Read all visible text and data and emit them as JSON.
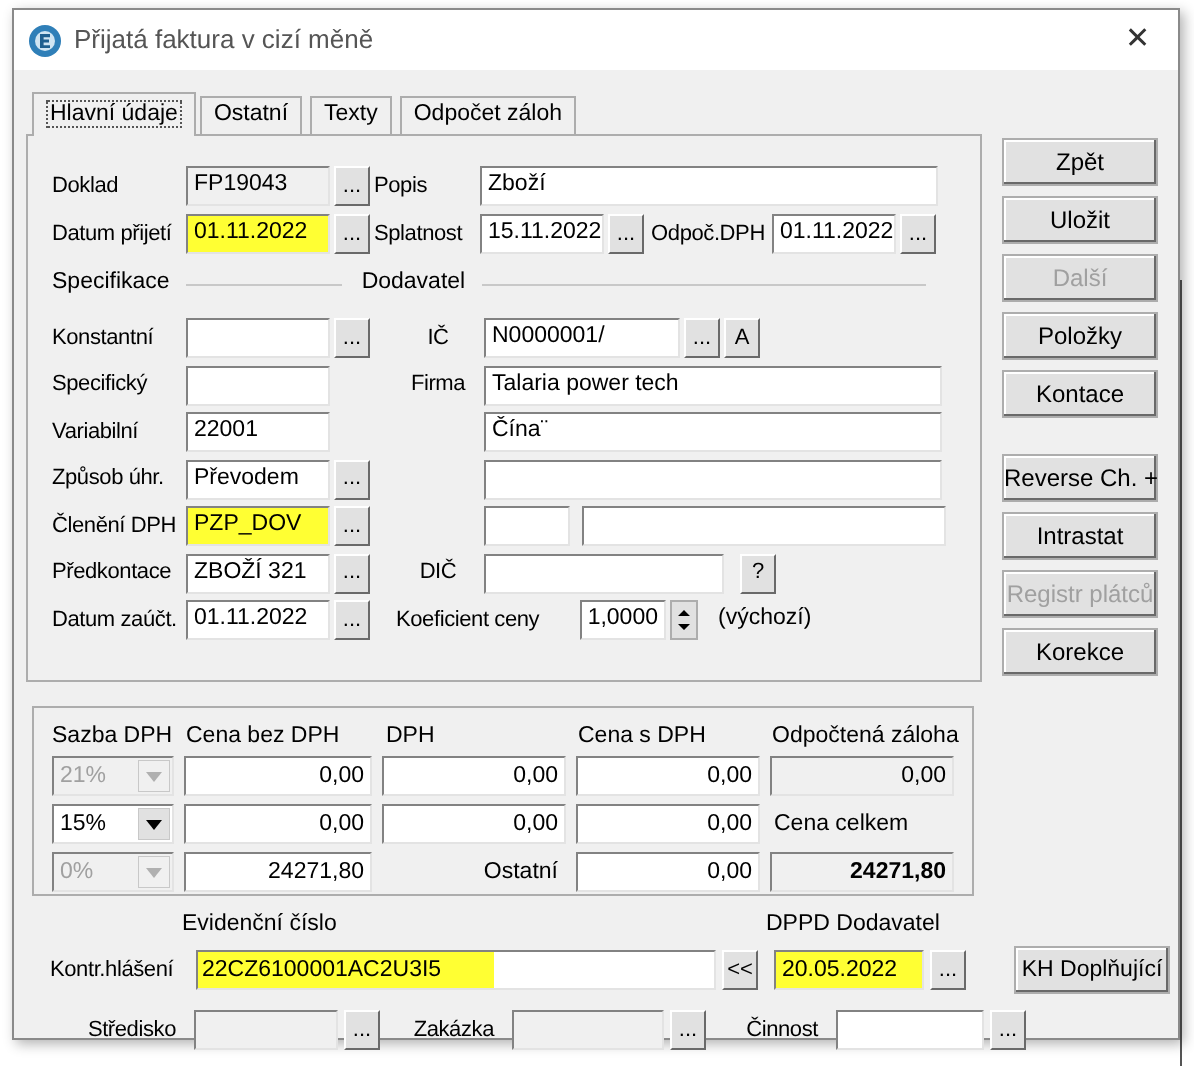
{
  "window": {
    "title": "Přijatá faktura v cizí měně",
    "close": "✕"
  },
  "tabs": [
    {
      "label": "Hlavní údaje",
      "selected": true
    },
    {
      "label": "Ostatní",
      "selected": false
    },
    {
      "label": "Texty",
      "selected": false
    },
    {
      "label": "Odpočet záloh",
      "selected": false
    }
  ],
  "main": {
    "doklad": {
      "label": "Doklad",
      "value": "FP19043",
      "readonly": true,
      "picker": "..."
    },
    "popis": {
      "label": "Popis",
      "value": "Zboží"
    },
    "datum_prijeti": {
      "label": "Datum přijetí",
      "value": "01.11.2022",
      "highlighted": true,
      "picker": "..."
    },
    "splatnost": {
      "label": "Splatnost",
      "value": "15.11.2022",
      "picker": "..."
    },
    "odpoc_dph": {
      "label": "Odpoč.DPH",
      "value": "01.11.2022",
      "picker": "..."
    },
    "specifikace_heading": "Specifikace",
    "dodavatel_heading": "Dodavatel",
    "specifikace": [
      {
        "label": "Konstantní",
        "picker": "...",
        "highlighted": false
      },
      {
        "label": "Specifický",
        "highlighted": false
      },
      {
        "label": "Variabilní",
        "value": "22001",
        "highlighted": false
      },
      {
        "label": "Způsob úhr.",
        "value": "Převodem",
        "picker": "...",
        "highlighted": false
      },
      {
        "label": "Členění DPH",
        "value": "PZP_DOV",
        "picker": "...",
        "highlighted": true
      },
      {
        "label": "Předkontace",
        "value": "ZBOŽÍ 321",
        "picker": "...",
        "highlighted": false
      },
      {
        "label": "Datum zaúčt.",
        "value": "01.11.2022",
        "picker": "...",
        "highlighted": false
      }
    ],
    "ic": {
      "label": "IČ",
      "value": "N0000001/",
      "picker": "...",
      "lookup": "A"
    },
    "firma": {
      "label": "Firma",
      "value": "Talaria power tech"
    },
    "address": [
      "Čína¨"
    ],
    "dic": {
      "label": "DIČ",
      "help": "?"
    },
    "koeficient": {
      "label": "Koeficient ceny",
      "value": "1,0000",
      "note": "(výchozí)"
    }
  },
  "action_groups": [
    {
      "buttons": [
        {
          "label": "Zpět",
          "disabled": false
        },
        {
          "label": "Uložit",
          "disabled": false
        },
        {
          "label": "Další",
          "disabled": true
        },
        {
          "label": "Položky",
          "disabled": false
        },
        {
          "label": "Kontace",
          "disabled": false
        }
      ]
    },
    {
      "buttons": [
        {
          "label": "Reverse Ch. +",
          "disabled": false
        },
        {
          "label": "Intrastat",
          "disabled": false
        },
        {
          "label": "Registr plátců",
          "disabled": true
        },
        {
          "label": "Korekce",
          "disabled": false
        }
      ]
    }
  ],
  "vat": {
    "headers": [
      "Sazba DPH",
      "Cena bez DPH",
      "DPH",
      "Cena s DPH",
      "Odpočtená záloha"
    ],
    "rows": [
      {
        "rate": "21%",
        "disabled": true,
        "base": "0,00",
        "vat": "0,00",
        "total": "0,00"
      },
      {
        "rate": "15%",
        "disabled": false,
        "base": "0,00",
        "vat": "0,00",
        "total": "0,00"
      },
      {
        "rate": "0%",
        "disabled": true,
        "base": "24271,80",
        "other_label": "Ostatní",
        "total": "0,00"
      }
    ],
    "advance": "0,00",
    "total_label": "Cena celkem",
    "total": "24271,80"
  },
  "control_report": {
    "header": "Evidenční číslo",
    "label": "Kontr.hlášení",
    "value": "22CZ6100001AC2U3I5",
    "highlighted": true,
    "transfer": "<<",
    "dppd_header": "DPPD Dodavatel",
    "dppd_value": "20.05.2022",
    "dppd_highlighted": true,
    "picker": "...",
    "extra_button": "KH Doplňující"
  },
  "bottom": [
    {
      "label": "Středisko",
      "readonly": true,
      "picker": "..."
    },
    {
      "label": "Zakázka",
      "readonly": true,
      "picker": "..."
    },
    {
      "label": "Činnost",
      "readonly": false,
      "picker": "..."
    }
  ]
}
